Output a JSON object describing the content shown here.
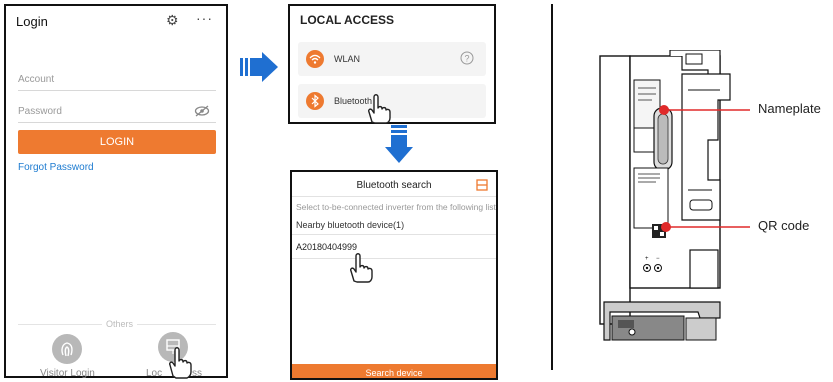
{
  "login_screen": {
    "title": "Login",
    "account_placeholder": "Account",
    "password_placeholder": "Password",
    "login_button": "LOGIN",
    "forgot_password": "Forgot Password",
    "others_label": "Others",
    "visitor_login": "Visitor Login",
    "local_access_partial": "Loc",
    "local_access_tail": "ss",
    "icons": [
      "settings-icon",
      "more-icon",
      "eye-off-icon",
      "fingerprint-icon",
      "local-access-icon"
    ]
  },
  "local_access_screen": {
    "header": "LOCAL ACCESS",
    "items": [
      {
        "label": "WLAN",
        "icon": "wifi-icon"
      },
      {
        "label": "Bluetooth",
        "icon": "bluetooth-icon"
      }
    ]
  },
  "bluetooth_screen": {
    "header": "Bluetooth search",
    "hint": "Select to-be-connected inverter from the following list",
    "nearby": "Nearby bluetooth device(1)",
    "device": "A20180404999",
    "search_button": "Search device"
  },
  "inverter": {
    "callouts": [
      "Nameplate",
      "QR code"
    ]
  },
  "colors": {
    "accent": "#ee7a30",
    "arrow_blue": "#1f6fd1",
    "callout_red": "#e02a2a",
    "link_blue": "#1d7bd0"
  }
}
